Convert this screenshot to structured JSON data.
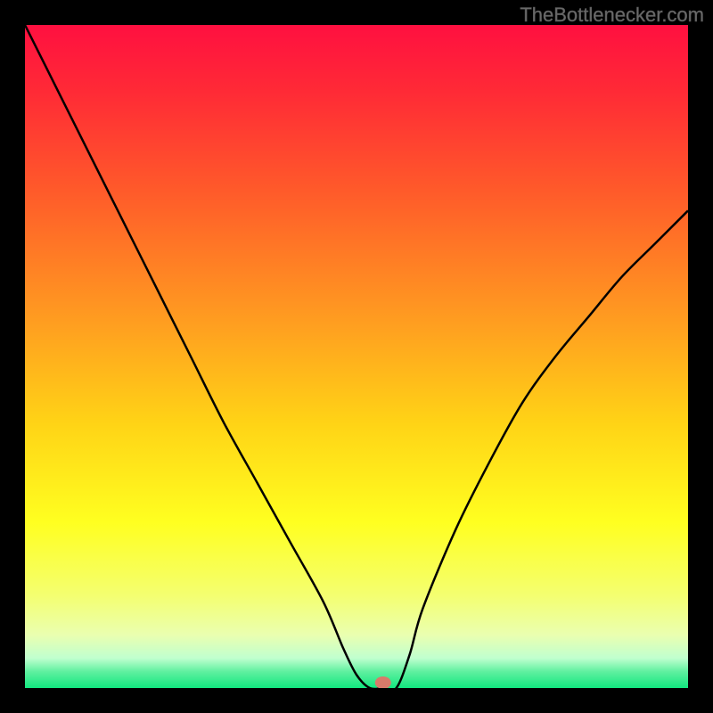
{
  "attribution": "TheBottlenecker.com",
  "chart_data": {
    "type": "line",
    "title": "",
    "xlabel": "",
    "ylabel": "",
    "xlim": [
      0,
      100
    ],
    "ylim": [
      0,
      100
    ],
    "series": [
      {
        "name": "curve",
        "x": [
          0,
          5,
          10,
          15,
          20,
          25,
          30,
          35,
          40,
          45,
          48,
          50,
          52,
          54,
          56,
          58,
          60,
          65,
          70,
          75,
          80,
          85,
          90,
          95,
          100
        ],
        "y": [
          100,
          90,
          80,
          70,
          60,
          50,
          40,
          31,
          22,
          13,
          6,
          2,
          0,
          0,
          0,
          5,
          12,
          24,
          34,
          43,
          50,
          56,
          62,
          67,
          72
        ]
      }
    ],
    "marker": {
      "x": 54,
      "y": 0
    },
    "gradient_stops": [
      {
        "offset": 0.0,
        "color": "#ff1040"
      },
      {
        "offset": 0.1,
        "color": "#ff2a36"
      },
      {
        "offset": 0.25,
        "color": "#ff5a2a"
      },
      {
        "offset": 0.45,
        "color": "#ff9e20"
      },
      {
        "offset": 0.6,
        "color": "#ffd316"
      },
      {
        "offset": 0.75,
        "color": "#ffff20"
      },
      {
        "offset": 0.86,
        "color": "#f4ff70"
      },
      {
        "offset": 0.92,
        "color": "#eaffb0"
      },
      {
        "offset": 0.955,
        "color": "#c0ffcf"
      },
      {
        "offset": 0.975,
        "color": "#60f0a0"
      },
      {
        "offset": 1.0,
        "color": "#12e77f"
      }
    ]
  }
}
